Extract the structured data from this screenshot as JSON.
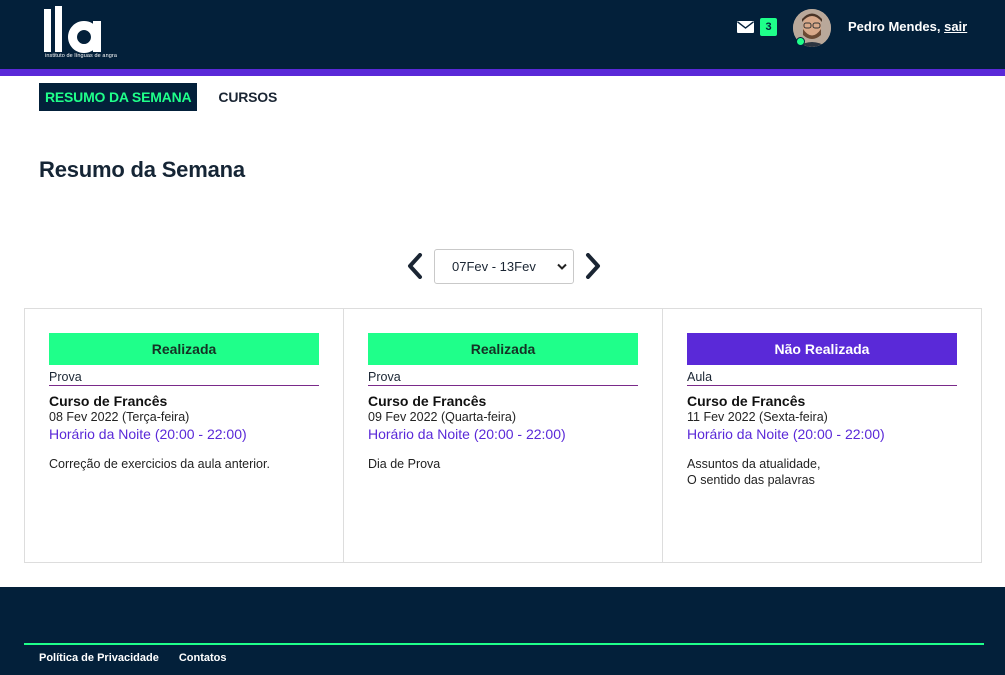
{
  "header": {
    "logo_text": "ila",
    "logo_tagline": "instituto de línguas de angra",
    "mail_count": "3",
    "user_name": "Pedro Mendes,",
    "logout_label": "sair"
  },
  "nav": {
    "tabs": [
      {
        "label": "RESUMO DA SEMANA",
        "active": true
      },
      {
        "label": "CURSOS",
        "active": false
      }
    ]
  },
  "page": {
    "title": "Resumo da Semana"
  },
  "week_selector": {
    "selected": "07Fev - 13Fev"
  },
  "cards": [
    {
      "status": "Realizada",
      "kind": "Prova",
      "course": "Curso de Francês",
      "date": "08 Fev 2022 (Terça-feira)",
      "time": "Horário da Noite (20:00 - 22:00)",
      "description": [
        "Correção de exercicios da aula anterior."
      ]
    },
    {
      "status": "Realizada",
      "kind": "Prova",
      "course": "Curso de Francês",
      "date": "09 Fev 2022 (Quarta-feira)",
      "time": "Horário da Noite (20:00 - 22:00)",
      "description": [
        "Dia de Prova"
      ]
    },
    {
      "status": "Não Realizada",
      "kind": "Aula",
      "course": "Curso de Francês",
      "date": "11 Fev 2022 (Sexta-feira)",
      "time": "Horário da Noite (20:00 - 22:00)",
      "description": [
        "Assuntos da atualidade,",
        "O sentido das palavras"
      ]
    }
  ],
  "footer": {
    "links": [
      "Política de Privacidade",
      "Contatos"
    ]
  },
  "colors": {
    "header_bg": "#03203a",
    "accent_purple": "#5a29d8",
    "accent_green": "#1fff8a"
  }
}
